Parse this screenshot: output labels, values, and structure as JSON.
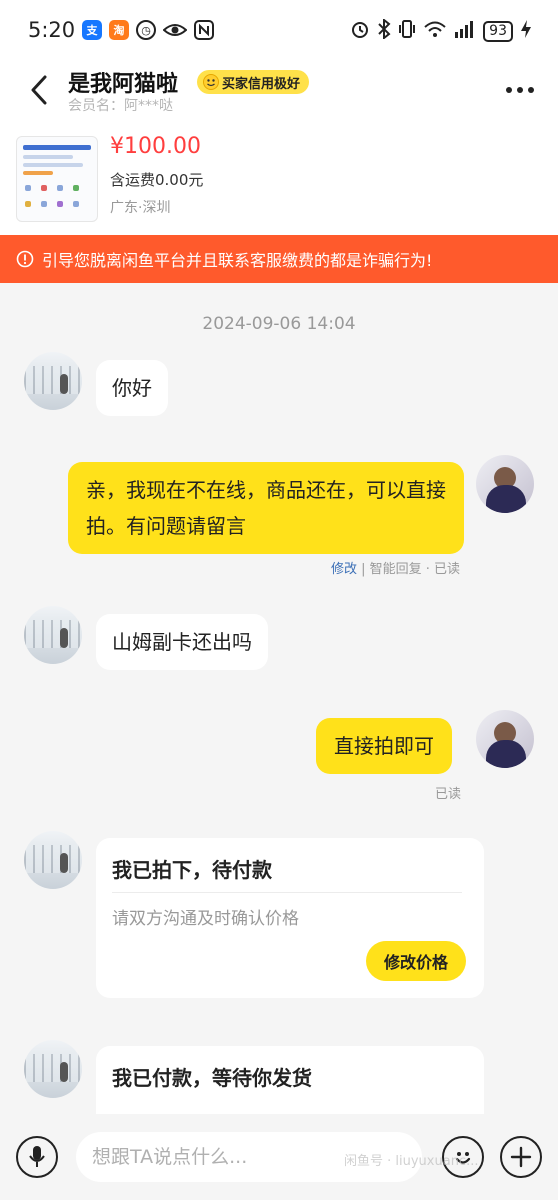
{
  "status_bar": {
    "time": "5:20",
    "battery": "93",
    "app_icons": [
      "alipay-icon",
      "taobao-icon",
      "clock-app-icon",
      "eye-icon",
      "nfc-icon"
    ],
    "system_icons": [
      "alarm-icon",
      "bluetooth-icon",
      "vibrate-icon",
      "wifi-icon",
      "signal-icon",
      "charging-icon"
    ]
  },
  "header": {
    "title": "是我阿猫啦",
    "credit_badge": "买家信用极好",
    "member_label": "会员名：",
    "member_name": "阿***哒"
  },
  "product": {
    "price": "¥100.00",
    "shipping": "含运费0.00元",
    "location": "广东·深圳"
  },
  "warning": {
    "text": "引导您脱离闲鱼平台并且联系客服缴费的都是诈骗行为!"
  },
  "chat": {
    "timestamp": "2024-09-06 14:04",
    "messages": [
      {
        "from": "other",
        "text": "你好"
      },
      {
        "from": "self",
        "text": "亲，我现在不在线，商品还在，可以直接拍。有问题请留言",
        "meta_edit": "修改",
        "meta_rest": " | 智能回复 · 已读"
      },
      {
        "from": "other",
        "text": "山姆副卡还出吗"
      },
      {
        "from": "self",
        "text": "直接拍即可",
        "meta_rest": "已读"
      }
    ],
    "card_1": {
      "title": "我已拍下，待付款",
      "subtitle": "请双方沟通及时确认价格",
      "button": "修改价格"
    },
    "card_2": {
      "title": "我已付款，等待你发货"
    }
  },
  "input_bar": {
    "placeholder": "想跟TA说点什么..."
  },
  "watermark": "闲鱼号 · liuyuxuanc...",
  "colors": {
    "brand_yellow": "#ffe11a",
    "warning_bg": "#ff5a2c",
    "price_red": "#ff3e3e"
  }
}
